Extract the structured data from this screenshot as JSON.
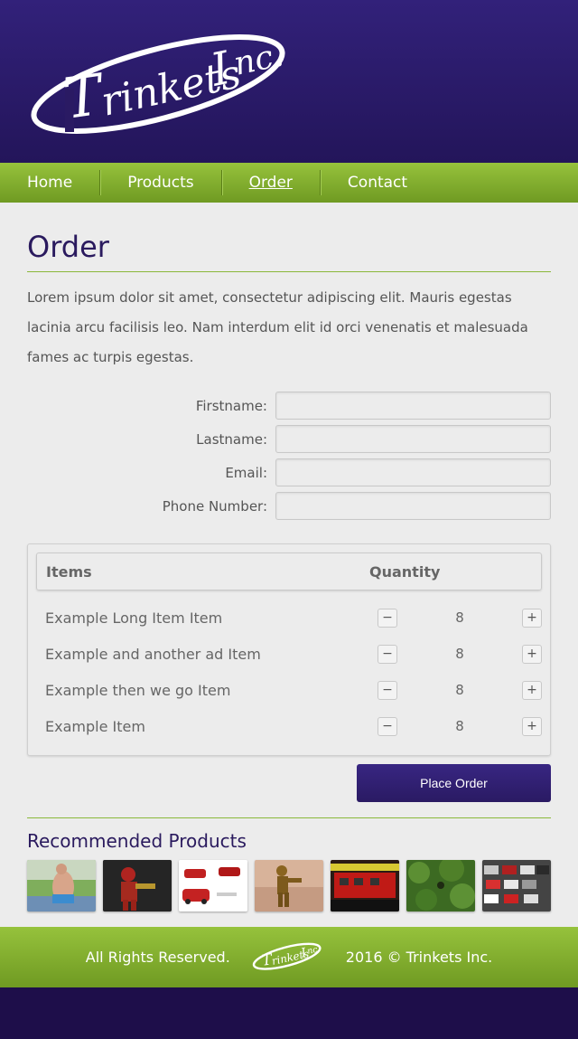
{
  "logo": {
    "text_main": "rinkets",
    "text_initial": "T",
    "text_suffix": "nc.",
    "text_i": "I"
  },
  "nav": {
    "items": [
      {
        "label": "Home",
        "active": false
      },
      {
        "label": "Products",
        "active": false
      },
      {
        "label": "Order",
        "active": true
      },
      {
        "label": "Contact",
        "active": false
      }
    ]
  },
  "page": {
    "title": "Order",
    "intro": "Lorem ipsum dolor sit amet, consectetur adipiscing elit. Mauris egestas lacinia arcu facilisis leo. Nam interdum elit id orci venenatis et malesuada fames ac turpis egestas."
  },
  "form": {
    "fields": [
      {
        "label": "Firstname:",
        "value": ""
      },
      {
        "label": "Lastname:",
        "value": ""
      },
      {
        "label": "Email:",
        "value": ""
      },
      {
        "label": "Phone Number:",
        "value": ""
      }
    ]
  },
  "items_table": {
    "header_items": "Items",
    "header_quantity": "Quantity",
    "rows": [
      {
        "name": "Example Long Item Item",
        "qty": "8"
      },
      {
        "name": "Example and another ad Item",
        "qty": "8"
      },
      {
        "name": "Example then we go Item",
        "qty": "8"
      },
      {
        "name": "Example Item",
        "qty": "8"
      }
    ],
    "minus": "−",
    "plus": "+"
  },
  "order_button": "Place Order",
  "recommended": {
    "title": "Recommended Products",
    "thumbnails": [
      "kangaroo-toy",
      "iron-man-figure",
      "red-cars",
      "bronze-figure",
      "red-toy-truck",
      "green-foliage",
      "toy-cars-traffic"
    ]
  },
  "footer": {
    "left": "All Rights Reserved.",
    "right": "2016 © Trinkets Inc."
  },
  "colors": {
    "header": "#2c1c6e",
    "nav": "#86b231",
    "accent_purple": "#2a1a63",
    "accent_green": "#8ab83a"
  }
}
